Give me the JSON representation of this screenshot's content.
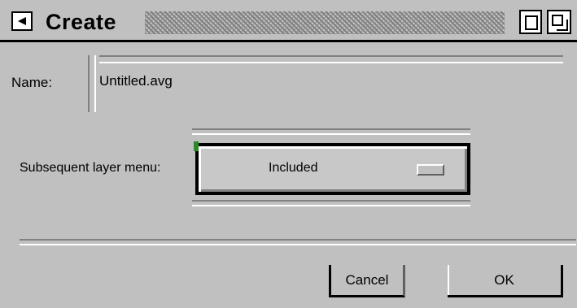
{
  "window": {
    "title": "Create"
  },
  "form": {
    "name_label": "Name:",
    "name_value": "Untitled.avg",
    "menu_label": "Subsequent layer menu:",
    "menu_value": "Included"
  },
  "buttons": {
    "cancel_label": "Cancel",
    "ok_label": "OK"
  }
}
